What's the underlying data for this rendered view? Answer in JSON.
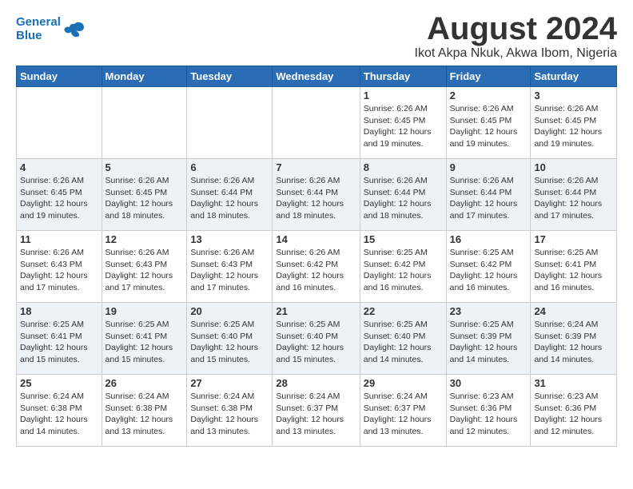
{
  "header": {
    "logo_line1": "General",
    "logo_line2": "Blue",
    "month_title": "August 2024",
    "location": "Ikot Akpa Nkuk, Akwa Ibom, Nigeria"
  },
  "weekdays": [
    "Sunday",
    "Monday",
    "Tuesday",
    "Wednesday",
    "Thursday",
    "Friday",
    "Saturday"
  ],
  "weeks": [
    [
      {
        "day": "",
        "info": ""
      },
      {
        "day": "",
        "info": ""
      },
      {
        "day": "",
        "info": ""
      },
      {
        "day": "",
        "info": ""
      },
      {
        "day": "1",
        "info": "Sunrise: 6:26 AM\nSunset: 6:45 PM\nDaylight: 12 hours\nand 19 minutes."
      },
      {
        "day": "2",
        "info": "Sunrise: 6:26 AM\nSunset: 6:45 PM\nDaylight: 12 hours\nand 19 minutes."
      },
      {
        "day": "3",
        "info": "Sunrise: 6:26 AM\nSunset: 6:45 PM\nDaylight: 12 hours\nand 19 minutes."
      }
    ],
    [
      {
        "day": "4",
        "info": "Sunrise: 6:26 AM\nSunset: 6:45 PM\nDaylight: 12 hours\nand 19 minutes."
      },
      {
        "day": "5",
        "info": "Sunrise: 6:26 AM\nSunset: 6:45 PM\nDaylight: 12 hours\nand 18 minutes."
      },
      {
        "day": "6",
        "info": "Sunrise: 6:26 AM\nSunset: 6:44 PM\nDaylight: 12 hours\nand 18 minutes."
      },
      {
        "day": "7",
        "info": "Sunrise: 6:26 AM\nSunset: 6:44 PM\nDaylight: 12 hours\nand 18 minutes."
      },
      {
        "day": "8",
        "info": "Sunrise: 6:26 AM\nSunset: 6:44 PM\nDaylight: 12 hours\nand 18 minutes."
      },
      {
        "day": "9",
        "info": "Sunrise: 6:26 AM\nSunset: 6:44 PM\nDaylight: 12 hours\nand 17 minutes."
      },
      {
        "day": "10",
        "info": "Sunrise: 6:26 AM\nSunset: 6:44 PM\nDaylight: 12 hours\nand 17 minutes."
      }
    ],
    [
      {
        "day": "11",
        "info": "Sunrise: 6:26 AM\nSunset: 6:43 PM\nDaylight: 12 hours\nand 17 minutes."
      },
      {
        "day": "12",
        "info": "Sunrise: 6:26 AM\nSunset: 6:43 PM\nDaylight: 12 hours\nand 17 minutes."
      },
      {
        "day": "13",
        "info": "Sunrise: 6:26 AM\nSunset: 6:43 PM\nDaylight: 12 hours\nand 17 minutes."
      },
      {
        "day": "14",
        "info": "Sunrise: 6:26 AM\nSunset: 6:42 PM\nDaylight: 12 hours\nand 16 minutes."
      },
      {
        "day": "15",
        "info": "Sunrise: 6:25 AM\nSunset: 6:42 PM\nDaylight: 12 hours\nand 16 minutes."
      },
      {
        "day": "16",
        "info": "Sunrise: 6:25 AM\nSunset: 6:42 PM\nDaylight: 12 hours\nand 16 minutes."
      },
      {
        "day": "17",
        "info": "Sunrise: 6:25 AM\nSunset: 6:41 PM\nDaylight: 12 hours\nand 16 minutes."
      }
    ],
    [
      {
        "day": "18",
        "info": "Sunrise: 6:25 AM\nSunset: 6:41 PM\nDaylight: 12 hours\nand 15 minutes."
      },
      {
        "day": "19",
        "info": "Sunrise: 6:25 AM\nSunset: 6:41 PM\nDaylight: 12 hours\nand 15 minutes."
      },
      {
        "day": "20",
        "info": "Sunrise: 6:25 AM\nSunset: 6:40 PM\nDaylight: 12 hours\nand 15 minutes."
      },
      {
        "day": "21",
        "info": "Sunrise: 6:25 AM\nSunset: 6:40 PM\nDaylight: 12 hours\nand 15 minutes."
      },
      {
        "day": "22",
        "info": "Sunrise: 6:25 AM\nSunset: 6:40 PM\nDaylight: 12 hours\nand 14 minutes."
      },
      {
        "day": "23",
        "info": "Sunrise: 6:25 AM\nSunset: 6:39 PM\nDaylight: 12 hours\nand 14 minutes."
      },
      {
        "day": "24",
        "info": "Sunrise: 6:24 AM\nSunset: 6:39 PM\nDaylight: 12 hours\nand 14 minutes."
      }
    ],
    [
      {
        "day": "25",
        "info": "Sunrise: 6:24 AM\nSunset: 6:38 PM\nDaylight: 12 hours\nand 14 minutes."
      },
      {
        "day": "26",
        "info": "Sunrise: 6:24 AM\nSunset: 6:38 PM\nDaylight: 12 hours\nand 13 minutes."
      },
      {
        "day": "27",
        "info": "Sunrise: 6:24 AM\nSunset: 6:38 PM\nDaylight: 12 hours\nand 13 minutes."
      },
      {
        "day": "28",
        "info": "Sunrise: 6:24 AM\nSunset: 6:37 PM\nDaylight: 12 hours\nand 13 minutes."
      },
      {
        "day": "29",
        "info": "Sunrise: 6:24 AM\nSunset: 6:37 PM\nDaylight: 12 hours\nand 13 minutes."
      },
      {
        "day": "30",
        "info": "Sunrise: 6:23 AM\nSunset: 6:36 PM\nDaylight: 12 hours\nand 12 minutes."
      },
      {
        "day": "31",
        "info": "Sunrise: 6:23 AM\nSunset: 6:36 PM\nDaylight: 12 hours\nand 12 minutes."
      }
    ]
  ]
}
